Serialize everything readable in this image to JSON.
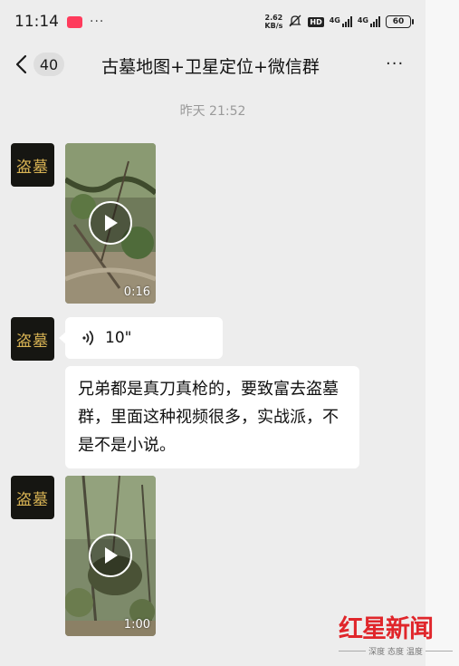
{
  "status_bar": {
    "time": "11:14",
    "more": "···",
    "net_speed_value": "2.62",
    "net_speed_unit": "KB/s",
    "hd_label": "HD",
    "signal_1_label": "4G",
    "signal_2_label": "4G",
    "battery": "60"
  },
  "nav": {
    "back_icon": "chevron-left-icon",
    "unread_count": "40",
    "title": "古墓地图+卫星定位+微信群",
    "more_icon": "more-horizontal-icon",
    "more_label": "···"
  },
  "chat": {
    "timestamp": "昨天 21:52",
    "messages": [
      {
        "type": "video",
        "sender_avatar_text": "盗墓",
        "duration": "0:16"
      },
      {
        "type": "voice",
        "sender_avatar_text": "盗墓",
        "duration": "10\""
      },
      {
        "type": "text",
        "text": "兄弟都是真刀真枪的，要致富去盗墓群，里面这种视频很多，实战派，不是不是小说。"
      },
      {
        "type": "video",
        "sender_avatar_text": "盗墓",
        "duration": "1:00"
      }
    ]
  },
  "watermark": {
    "logo": "红星新闻",
    "tagline": "深度 态度 温度"
  },
  "colors": {
    "background": "#ededed",
    "bubble": "#ffffff",
    "watermark_red": "#e0262b",
    "avatar_text": "#d9b454"
  }
}
